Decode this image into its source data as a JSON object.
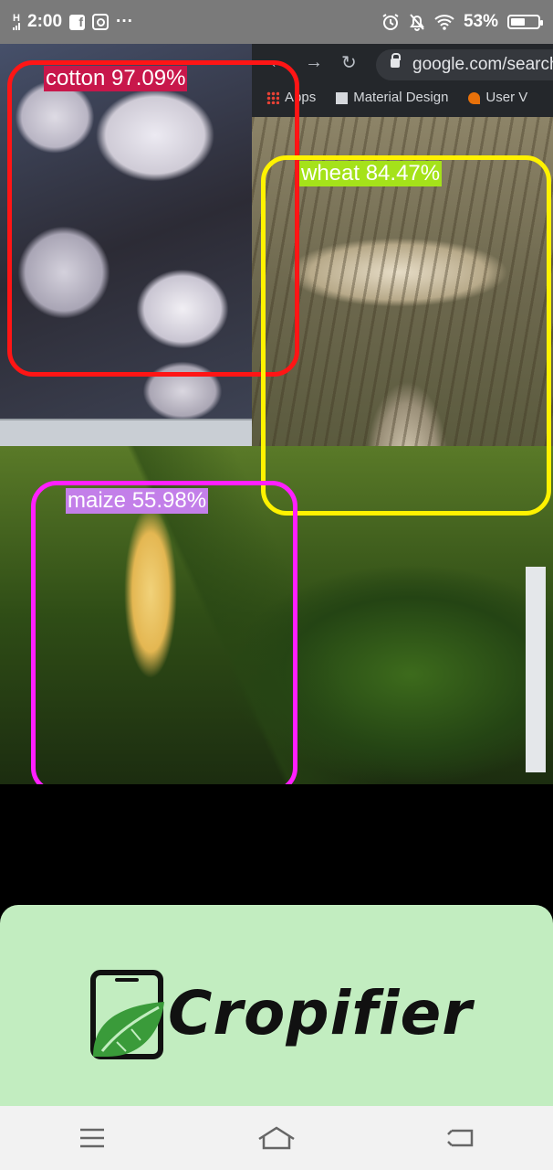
{
  "status_bar": {
    "network": "H",
    "time": "2:00",
    "notification_icons": [
      "facebook-icon",
      "instagram-icon"
    ],
    "more_notifications": "···",
    "battery_percent": "53%",
    "battery_level": 0.53
  },
  "browser": {
    "url": "google.com/search?",
    "bookmarks": [
      "Apps",
      "Material Design",
      "User V"
    ]
  },
  "detections": [
    {
      "label": "cotton 97.09%",
      "color": "#ff1515"
    },
    {
      "label": "wheat 84.47%",
      "color": "#fff200"
    },
    {
      "label": "maize 55.98%",
      "color": "#ff1fff"
    }
  ],
  "app": {
    "name": "Cropifier",
    "logo_bg": "#c2edc0",
    "accent": "#3a9b3a"
  },
  "nav_bar": {
    "buttons": [
      "menu-icon",
      "home-icon",
      "back-icon"
    ]
  }
}
